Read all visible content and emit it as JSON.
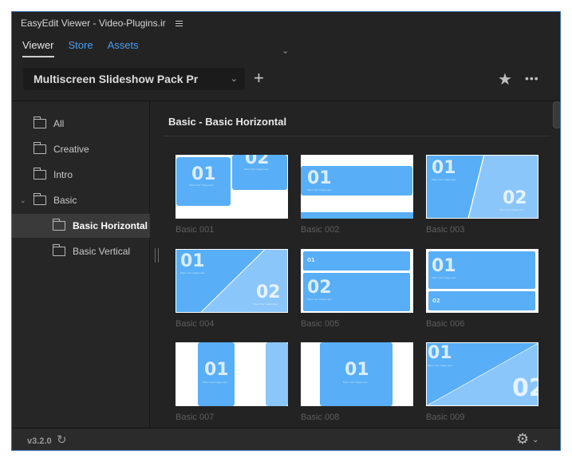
{
  "window": {
    "title": "EasyEdit Viewer - Video-Plugins.ir"
  },
  "tabs": [
    {
      "label": "Viewer",
      "active": true
    },
    {
      "label": "Store"
    },
    {
      "label": "Assets"
    }
  ],
  "toolbar": {
    "pack_name": "Multiscreen Slideshow Pack Pr"
  },
  "sidebar": {
    "items": [
      {
        "label": "All"
      },
      {
        "label": "Creative"
      },
      {
        "label": "Intro"
      },
      {
        "label": "Basic",
        "expanded": true
      },
      {
        "label": "Basic Horizontal",
        "selected": true
      },
      {
        "label": "Basic Vertical"
      }
    ]
  },
  "content": {
    "section_title": "Basic - Basic Horizontal",
    "cards": [
      {
        "label": "Basic 001"
      },
      {
        "label": "Basic 002"
      },
      {
        "label": "Basic 003"
      },
      {
        "label": "Basic 004"
      },
      {
        "label": "Basic 005"
      },
      {
        "label": "Basic 006"
      },
      {
        "label": "Basic 007"
      },
      {
        "label": "Basic 008"
      },
      {
        "label": "Basic 009"
      }
    ]
  },
  "thumb_text": {
    "n1": "01",
    "n2": "02",
    "caption": "Place Your Image Here"
  },
  "status": {
    "version": "v3.2.0"
  },
  "colors": {
    "accent": "#4a9df0",
    "thumb_blue": "#58aef7",
    "thumb_light": "#8bc6fb",
    "window_bg": "#232323"
  }
}
